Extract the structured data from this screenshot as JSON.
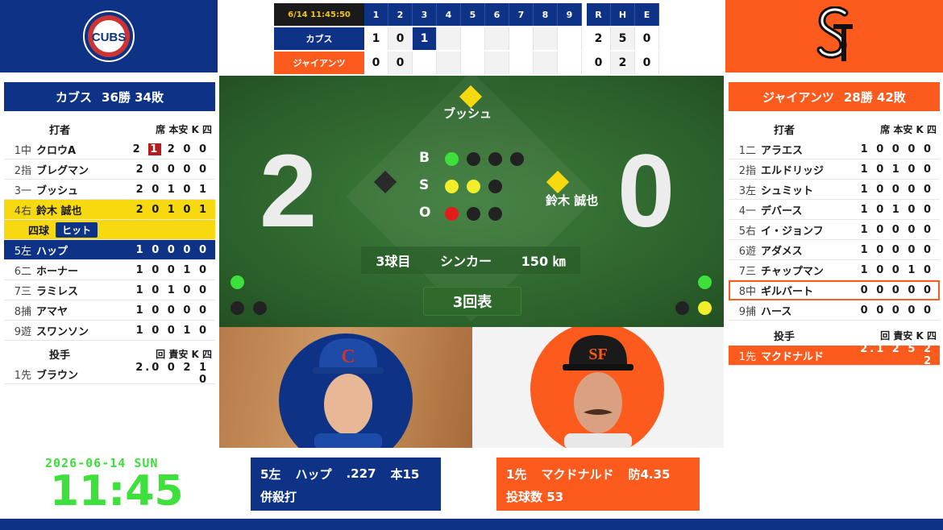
{
  "colors": {
    "cubs_blue": "#0e3386",
    "giants_orange": "#fd5a1e",
    "highlight_yellow": "#f6d90e",
    "field_green": "#2b612b",
    "clock_green": "#3ee03c"
  },
  "logos": {
    "left_icon": "cubs-logo",
    "left_text": "CUBS",
    "right_icon": "giants-sf-logo"
  },
  "linescore": {
    "time": "6/14 11:45:50",
    "innings": [
      "1",
      "2",
      "3",
      "4",
      "5",
      "6",
      "7",
      "8",
      "9"
    ],
    "totals_header": [
      "R",
      "H",
      "E"
    ],
    "away": {
      "name": "カブス",
      "innings": [
        "1",
        "0",
        "1",
        "",
        "",
        "",
        "",
        "",
        ""
      ],
      "totals": [
        "2",
        "5",
        "0"
      ]
    },
    "home": {
      "name": "ジャイアンツ",
      "innings": [
        "0",
        "0",
        "",
        "",
        "",
        "",
        "",
        "",
        ""
      ],
      "totals": [
        "0",
        "2",
        "0"
      ]
    }
  },
  "away_panel": {
    "team": "カブス",
    "record": "36勝 34敗",
    "batters_header": "打者",
    "batters_cols": "席 本安 K 四",
    "batters": [
      {
        "num": "1中",
        "name": "クロウA",
        "stats": "2 1 2 0 0"
      },
      {
        "num": "2指",
        "name": "ブレグマン",
        "stats": "2 0 0 0 0"
      },
      {
        "num": "3一",
        "name": "ブッシュ",
        "stats": "2 0 1 0 1"
      },
      {
        "num": "4右",
        "name": "鈴木 誠也",
        "stats": "2 0 1 0 1"
      },
      {
        "num": "5左",
        "name": "ハップ",
        "stats": "1 0 0 0 0"
      },
      {
        "num": "6二",
        "name": "ホーナー",
        "stats": "1 0 0 1 0"
      },
      {
        "num": "7三",
        "name": "ラミレス",
        "stats": "1 0 1 0 0"
      },
      {
        "num": "8捕",
        "name": "アマヤ",
        "stats": "1 0 0 0 0"
      },
      {
        "num": "9遊",
        "name": "スワンソン",
        "stats": "1 0 0 1 0"
      }
    ],
    "event_prev": "四球",
    "event_hit": "ヒット",
    "pitchers_header": "投手",
    "pitchers_cols": "回 責安 K 四",
    "pitchers": [
      {
        "num": "1先",
        "name": "ブラウン",
        "stats": "2.0 0 2 1 0"
      }
    ]
  },
  "home_panel": {
    "team": "ジャイアンツ",
    "record": "28勝 42敗",
    "batters_header": "打者",
    "batters_cols": "席 本安 K 四",
    "batters": [
      {
        "num": "1二",
        "name": "アラエス",
        "stats": "1 0 0 0 0"
      },
      {
        "num": "2指",
        "name": "エルドリッジ",
        "stats": "1 0 1 0 0"
      },
      {
        "num": "3左",
        "name": "シュミット",
        "stats": "1 0 0 0 0"
      },
      {
        "num": "4一",
        "name": "デバース",
        "stats": "1 0 1 0 0"
      },
      {
        "num": "5右",
        "name": "イ・ジョンフ",
        "stats": "1 0 0 0 0"
      },
      {
        "num": "6遊",
        "name": "アダメス",
        "stats": "1 0 0 0 0"
      },
      {
        "num": "7三",
        "name": "チャップマン",
        "stats": "1 0 0 1 0"
      },
      {
        "num": "8中",
        "name": "ギルバート",
        "stats": "0 0 0 0 0"
      },
      {
        "num": "9捕",
        "name": "ハース",
        "stats": "0 0 0 0 0"
      }
    ],
    "pitchers_header": "投手",
    "pitchers_cols": "回 責安 K 四",
    "pitchers": [
      {
        "num": "1先",
        "name": "マクドナルド",
        "stats": "2.1 2 5 2 2"
      }
    ]
  },
  "field": {
    "away_score": "2",
    "home_score": "0",
    "runner_second": "ブッシュ",
    "runner_first": "鈴木 誠也",
    "count_labels": [
      "B",
      "S",
      "O"
    ],
    "balls": 1,
    "strikes": 2,
    "outs": 1,
    "pitch_number": "3球目",
    "pitch_type": "シンカー",
    "pitch_speed": "150 ㎞",
    "inning": "3回表"
  },
  "batter_info": {
    "order": "5左",
    "name": "ハップ",
    "avg": ".227",
    "hr": "本15",
    "result": "併殺打"
  },
  "pitcher_info": {
    "order": "1先",
    "name": "マクドナルド",
    "era": "防4.35",
    "pitch_count": "投球数 53"
  },
  "clock": {
    "date": "2026-06-14 SUN",
    "time": "11:45"
  }
}
